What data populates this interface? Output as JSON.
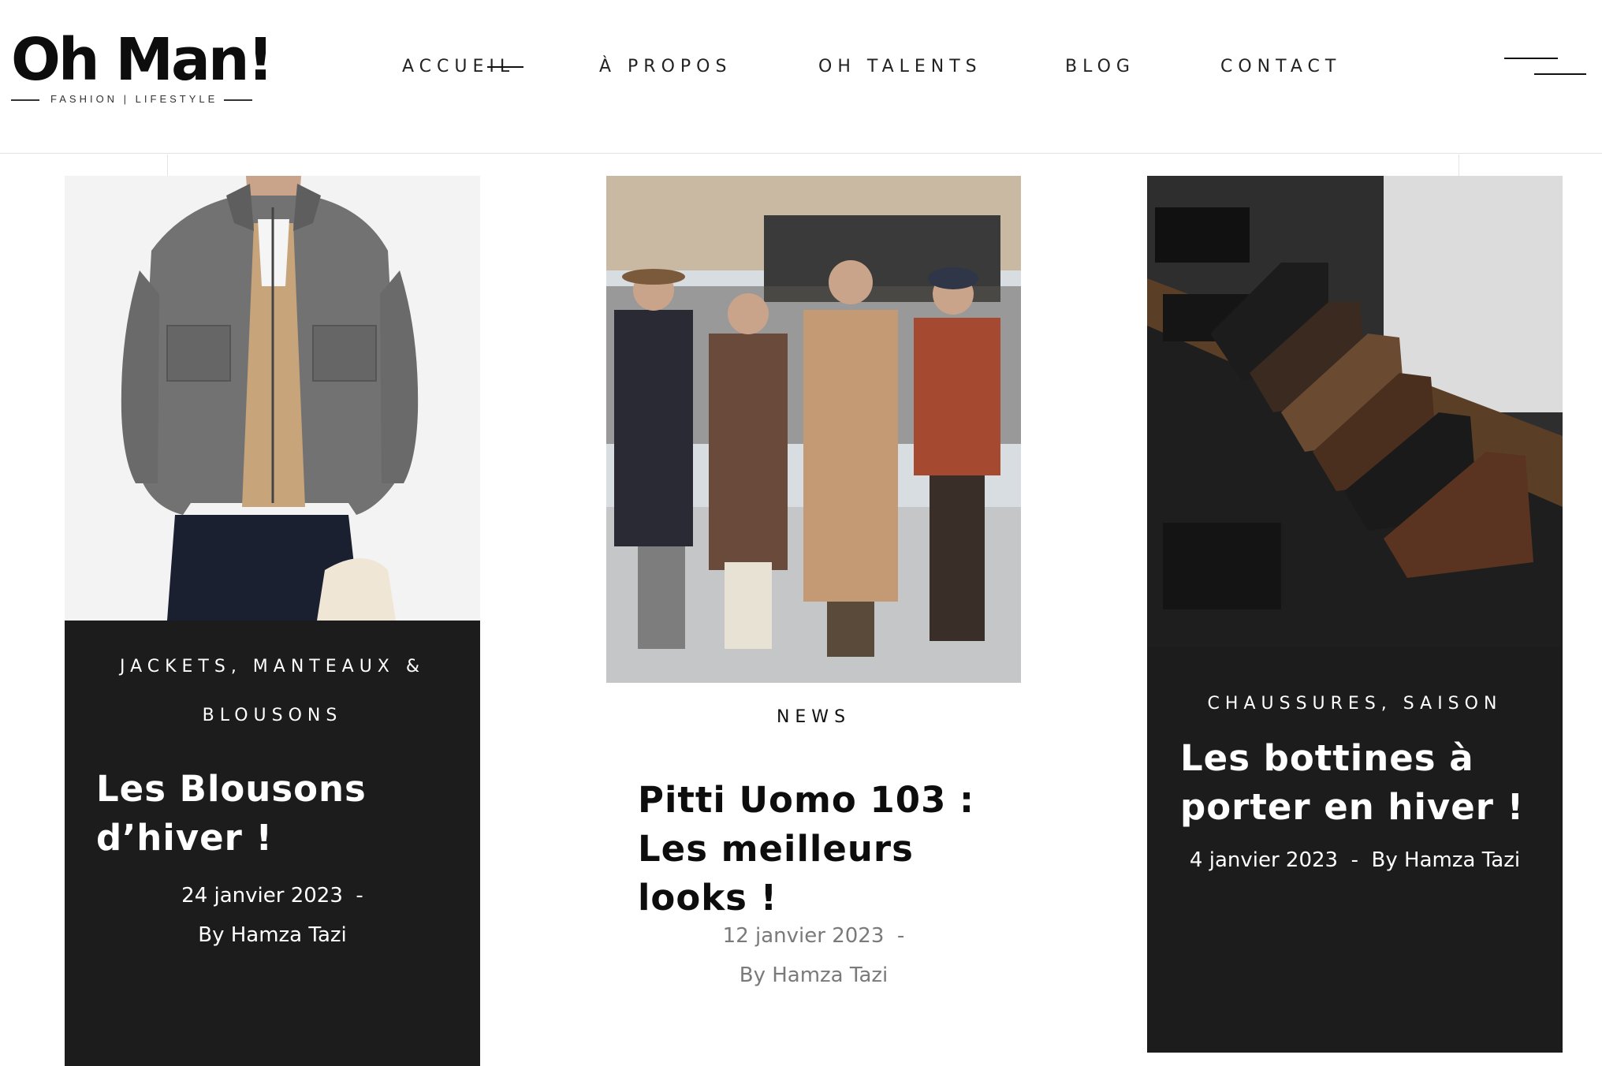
{
  "brand": {
    "name": "Oh Man!",
    "tagline": "FASHION | LIFESTYLE"
  },
  "nav": {
    "items": [
      {
        "label": "ACCUEIL",
        "active": true
      },
      {
        "label": "À PROPOS"
      },
      {
        "label": "OH TALENTS"
      },
      {
        "label": "BLOG"
      },
      {
        "label": "CONTACT"
      }
    ]
  },
  "posts": [
    {
      "category_line1": "JACKETS, MANTEAUX &",
      "category_line2": "BLOUSONS",
      "title_line1": "Les Blousons",
      "title_line2": "d’hiver !",
      "date": "24 janvier 2023",
      "separator": "-",
      "author": "By Hamza Tazi"
    },
    {
      "category": "NEWS",
      "title_line1": "Pitti Uomo 103 :",
      "title_line2": "Les meilleurs",
      "title_line3": "looks !",
      "date": "12 janvier 2023",
      "separator": "-",
      "author": "By Hamza Tazi"
    },
    {
      "category": "CHAUSSURES, SAISON",
      "title_line1": "Les bottines à",
      "title_line2": "porter en hiver !",
      "date": "4 janvier 2023",
      "separator": "-",
      "author": "By Hamza Tazi"
    }
  ],
  "colors": {
    "dark_panel": "#1c1c1d",
    "text": "#111111",
    "muted": "#7a7a7a",
    "background": "#ffffff"
  }
}
